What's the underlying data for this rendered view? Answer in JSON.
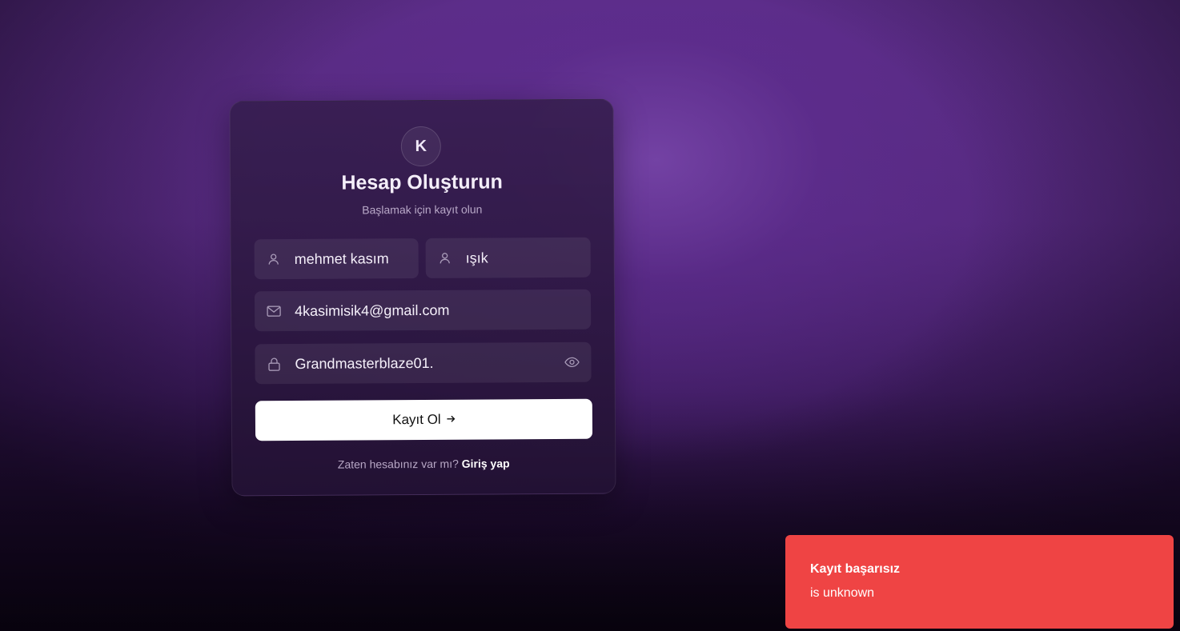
{
  "form": {
    "logo_letter": "K",
    "title": "Hesap Oluşturun",
    "subtitle": "Başlamak için kayıt olun",
    "first_name": {
      "value": "mehmet kasım",
      "icon": "user-icon"
    },
    "last_name": {
      "value": "ışık",
      "icon": "user-icon"
    },
    "email": {
      "value": "4kasimisik4@gmail.com",
      "icon": "mail-icon"
    },
    "password": {
      "value": "Grandmasterblaze01.",
      "icon": "lock-icon",
      "toggle_icon": "eye-icon"
    },
    "submit_label": "Kayıt Ol",
    "submit_icon": "arrow-right-icon",
    "footer_text": "Zaten hesabınız var mı?",
    "footer_link": "Giriş yap"
  },
  "toast": {
    "title": "Kayıt başarısız",
    "message": "is unknown",
    "color": "#ef4444"
  },
  "colors": {
    "background": "#5b2d86",
    "card": "#2f1846",
    "button": "#ffffff"
  }
}
